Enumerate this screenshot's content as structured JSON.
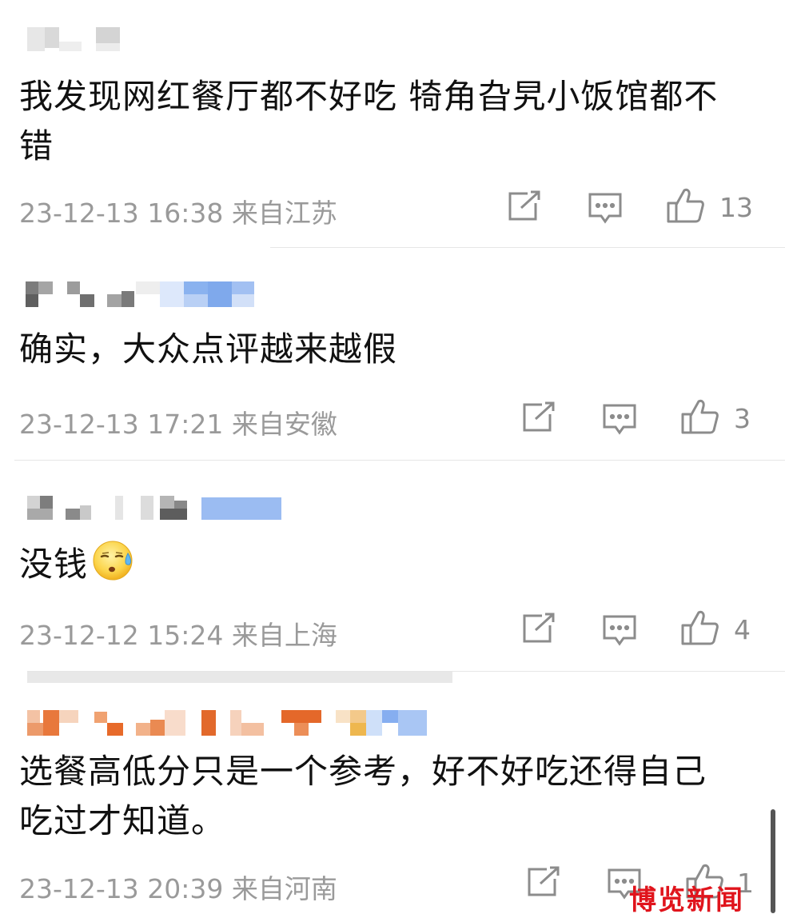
{
  "comments": [
    {
      "text": "我发现网红餐厅都不好吃 犄角旮旯小饭馆都不错",
      "meta": "23-12-13 16:38 来自江苏",
      "likes": "13"
    },
    {
      "text": "确实，大众点评越来越假",
      "meta": "23-12-13 17:21 来自安徽",
      "likes": "3"
    },
    {
      "text": "没钱",
      "emoji": "sweat-sleepy-emoji",
      "meta": "23-12-12 15:24 来自上海",
      "likes": "4"
    },
    {
      "text": "选餐高低分只是一个参考，好不好吃还得自己吃过才知道。",
      "meta": "23-12-13 20:39 来自河南",
      "likes": "1"
    }
  ],
  "icons": {
    "share": "share-icon",
    "comment": "comment-icon",
    "like": "thumbs-up-icon"
  },
  "watermark": "博览新闻",
  "colors": {
    "meta_text": "#9a9a9a",
    "icon": "#8c8c8c",
    "watermark": "#e0141c"
  }
}
